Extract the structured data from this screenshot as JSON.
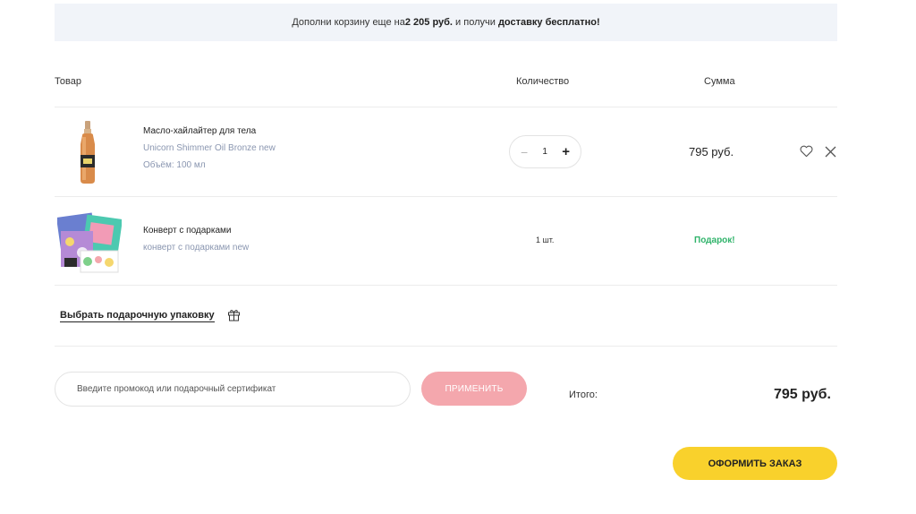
{
  "banner": {
    "prefix": "Дополни корзину еще на ",
    "amount": "2 205 руб.",
    "middle": " и получи ",
    "highlight": "доставку бесплатно!"
  },
  "table_header": {
    "product": "Товар",
    "quantity": "Количество",
    "sum": "Сумма"
  },
  "items": [
    {
      "title": "Масло-хайлайтер для тела",
      "subtitle": "Unicorn Shimmer Oil Bronze new",
      "volume": "Объём: 100 мл",
      "quantity": "1",
      "minus": "−",
      "plus": "+",
      "price": "795 руб.",
      "icons": [
        "heart-icon",
        "close-icon"
      ]
    },
    {
      "title": "Конверт с подарками",
      "subtitle": "конверт с подарками new",
      "quantity": "1 шт.",
      "price_label": "Подарок!"
    }
  ],
  "gift_wrap": {
    "label": "Выбрать подарочную упаковку",
    "icon": "gift-icon"
  },
  "promo": {
    "placeholder": "Введите промокод или подарочный сертификат",
    "value": "",
    "apply_label": "ПРИМЕНИТЬ"
  },
  "total": {
    "label": "Итого:",
    "value": "795 руб."
  },
  "checkout_label": "ОФОРМИТЬ ЗАКАЗ",
  "colors": {
    "banner_bg": "#f1f4f9",
    "apply_button": "#f4a7ad",
    "checkout_button": "#f9d12c",
    "gift_label": "#2fb36a",
    "subtitle": "#8a96b0"
  }
}
